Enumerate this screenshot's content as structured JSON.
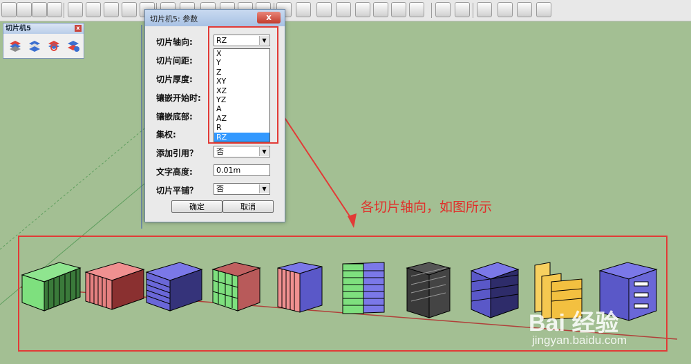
{
  "toolbar": {
    "icons": [
      "camera-icon",
      "paint-bucket-icon",
      "lock-icon",
      "sketch-icon",
      "tape-icon",
      "box-view-icon",
      "page-icon",
      "shape-icon",
      "shape-icon",
      "slicer-icon",
      "stack-icon",
      "home-icon",
      "house-icon",
      "house-outline-icon",
      "garage-icon",
      "doc-icon",
      "export-icon",
      "pipe-icon",
      "pipe-icon",
      "tool-icon",
      "tool-icon",
      "tool-icon",
      "zoom-icon",
      "sandbox-icon",
      "pencil-icon",
      "shape-icon",
      "circle-icon",
      "shape-icon",
      "shape-icon"
    ]
  },
  "minipanel": {
    "title": "切片机5",
    "close": "x"
  },
  "dialog": {
    "title": "切片机5: 参数",
    "close": "x",
    "labels": {
      "axis": "切片轴向:",
      "spacing": "切片间距:",
      "thickness": "切片厚度:",
      "inlay_start": "镶嵌开始时:",
      "inlay_bottom": "镶嵌底部:",
      "set": "集权:",
      "add_ref": "添加引用？",
      "text_height": "文字高度:",
      "flatten": "切片平铺？"
    },
    "fields": {
      "axis": "RZ",
      "add_ref": "否",
      "text_height": "0.01m",
      "flatten": "否"
    },
    "options": [
      "X",
      "Y",
      "Z",
      "XY",
      "XZ",
      "YZ",
      "A",
      "AZ",
      "R",
      "RZ"
    ],
    "selected_option": "RZ",
    "ok": "确定",
    "cancel": "取消"
  },
  "annotation": "各切片轴向，如图所示",
  "watermark": {
    "brand": "Bai 经验",
    "url": "jingyan.baidu.com"
  },
  "colors": {
    "highlight": "#e23a36",
    "selection": "#3399ff",
    "background": "#a3bf93"
  }
}
